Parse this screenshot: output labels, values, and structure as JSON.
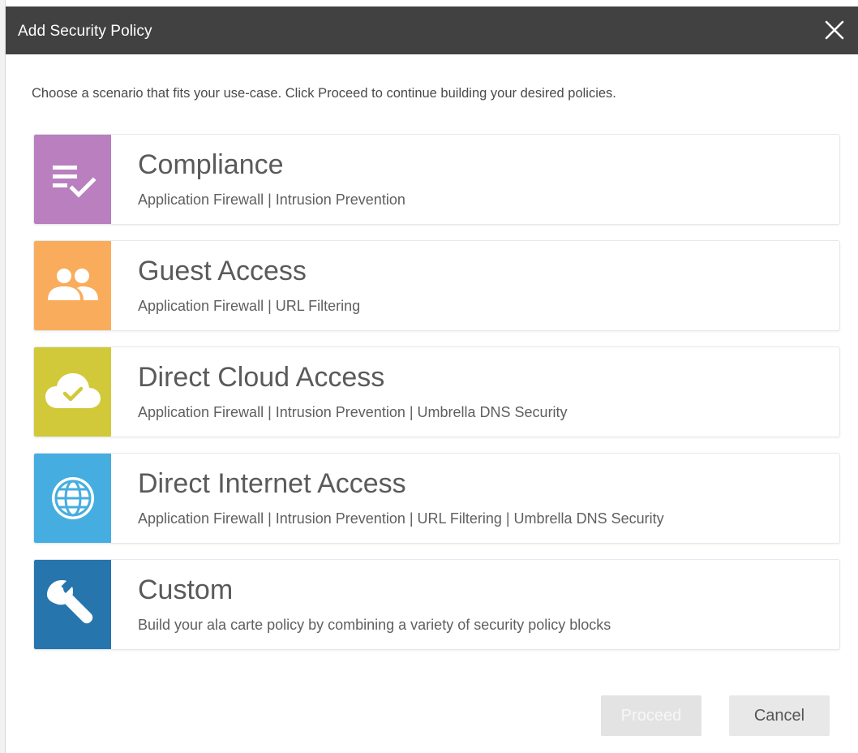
{
  "dialog": {
    "title": "Add Security Policy",
    "close_icon": "close-icon",
    "intro": "Choose a scenario that fits your use-case. Click Proceed to continue building your desired policies."
  },
  "scenarios": [
    {
      "title": "Compliance",
      "description": "Application Firewall | Intrusion Prevention",
      "icon": "checklist-icon",
      "color": "#b97fbf"
    },
    {
      "title": "Guest Access",
      "description": "Application Firewall | URL Filtering",
      "icon": "people-icon",
      "color": "#f9ad5c"
    },
    {
      "title": "Direct Cloud Access",
      "description": "Application Firewall | Intrusion Prevention | Umbrella DNS Security",
      "icon": "cloud-check-icon",
      "color": "#d2c93a"
    },
    {
      "title": "Direct Internet Access",
      "description": "Application Firewall | Intrusion Prevention | URL Filtering | Umbrella DNS Security",
      "icon": "globe-icon",
      "color": "#46ade0"
    },
    {
      "title": "Custom",
      "description": "Build your ala carte policy by combining a variety of security policy blocks",
      "icon": "wrench-icon",
      "color": "#2775ad"
    }
  ],
  "buttons": {
    "proceed": "Proceed",
    "cancel": "Cancel"
  },
  "colors": {
    "titlebar": "#414141",
    "button_disabled": "#e3e3e3"
  }
}
